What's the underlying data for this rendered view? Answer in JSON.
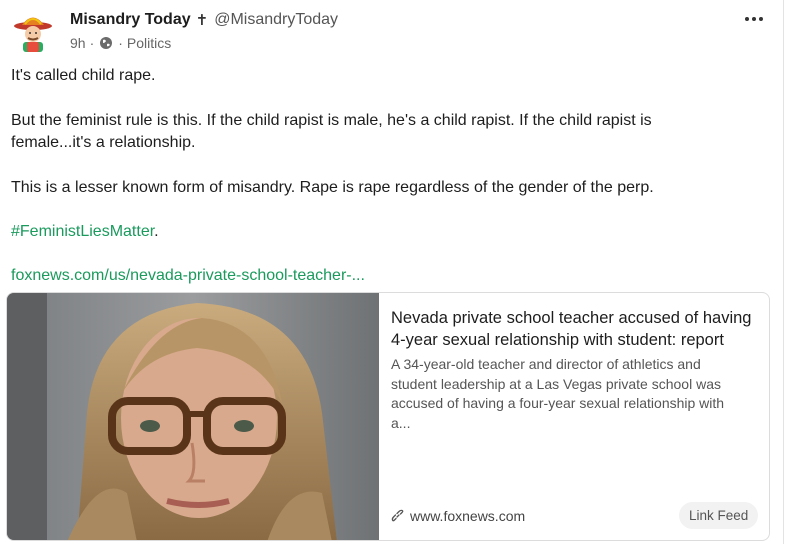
{
  "post": {
    "author": {
      "name": "Misandry Today",
      "badge": "✝",
      "handle": "@MisandryToday"
    },
    "meta": {
      "time": "9h",
      "separator": "·",
      "visibility_icon": "globe-icon",
      "category": "Politics"
    },
    "more_icon": "more-horizontal-icon",
    "paragraphs": [
      "It's called child rape.",
      "But the feminist rule is this. If the child rapist is male, he's a child rapist. If the child rapist is",
      "female...it's a relationship.",
      "This is a lesser known form of misandry. Rape is rape regardless of the gender of the perp."
    ],
    "hashtag": "#FeministLiesMatter",
    "hashtag_suffix": ".",
    "link_text": "foxnews.com/us/nevada-private-school-teacher-..."
  },
  "card": {
    "title_line1": "Nevada private school teacher accused of having",
    "title_line2": "4-year sexual relationship with student: report",
    "desc_line1": "A 34-year-old teacher and director of athletics and",
    "desc_line2": "student leadership at a Las Vegas private school was",
    "desc_line3": "accused of having a four-year sexual relationship with",
    "desc_line4": "a...",
    "domain_icon": "link-icon",
    "domain": "www.foxnews.com",
    "badge": "Link Feed"
  },
  "colors": {
    "accent_green": "#1a9a5c",
    "text": "#1d1d1d",
    "muted": "#666666"
  }
}
